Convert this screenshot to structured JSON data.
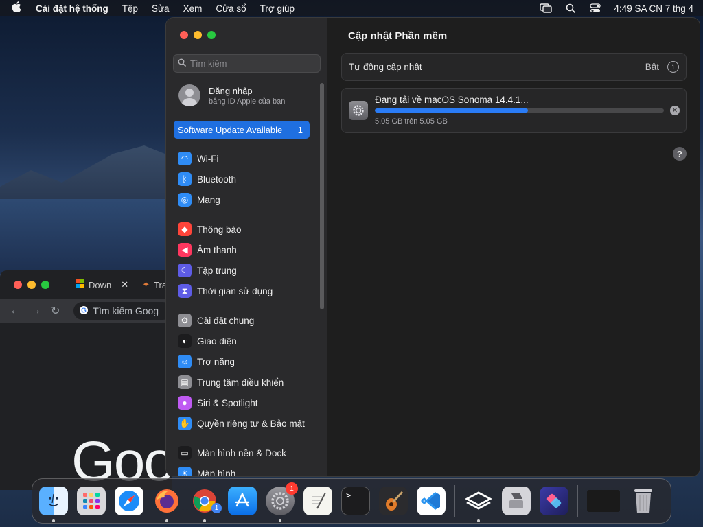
{
  "menubar": {
    "app_name": "Cài đặt hệ thống",
    "items": [
      "Tệp",
      "Sửa",
      "Xem",
      "Cửa sổ",
      "Trợ giúp"
    ],
    "clock": "4:49 SA CN 7 thg 4"
  },
  "chrome": {
    "tab1": "Down",
    "tab2": "Tra",
    "omnibox_placeholder": "Tìm kiếm Goog",
    "logo_text": "Goo"
  },
  "sidebar": {
    "search_placeholder": "Tìm kiếm",
    "account_name": "Đăng nhập",
    "account_sub": "bằng ID Apple của bạn",
    "update_label": "Software Update Available",
    "update_count": "1",
    "groups": [
      [
        {
          "label": "Wi-Fi",
          "icon": "wifi-icon",
          "color": "#2f8cf5"
        },
        {
          "label": "Bluetooth",
          "icon": "bluetooth-icon",
          "color": "#2f8cf5"
        },
        {
          "label": "Mạng",
          "icon": "globe-icon",
          "color": "#2f8cf5"
        }
      ],
      [
        {
          "label": "Thông báo",
          "icon": "bell-icon",
          "color": "#ff453a"
        },
        {
          "label": "Âm thanh",
          "icon": "speaker-icon",
          "color": "#ff375f"
        },
        {
          "label": "Tập trung",
          "icon": "moon-icon",
          "color": "#5e5ce6"
        },
        {
          "label": "Thời gian sử dụng",
          "icon": "hourglass-icon",
          "color": "#5e5ce6"
        }
      ],
      [
        {
          "label": "Cài đặt chung",
          "icon": "gear-icon",
          "color": "#8e8e93"
        },
        {
          "label": "Giao diện",
          "icon": "appearance-icon",
          "color": "#1c1c1e"
        },
        {
          "label": "Trợ năng",
          "icon": "accessibility-icon",
          "color": "#2f8cf5"
        },
        {
          "label": "Trung tâm điều khiển",
          "icon": "control-center-icon",
          "color": "#8e8e93"
        },
        {
          "label": "Siri & Spotlight",
          "icon": "siri-icon",
          "color": "#bf5af2"
        },
        {
          "label": "Quyền riêng tư & Bảo mật",
          "icon": "hand-icon",
          "color": "#2f8cf5"
        }
      ],
      [
        {
          "label": "Màn hình nền & Dock",
          "icon": "dock-icon",
          "color": "#1c1c1e"
        },
        {
          "label": "Màn hình",
          "icon": "sun-icon",
          "color": "#2f8cf5"
        }
      ]
    ]
  },
  "main": {
    "title": "Cập nhật Phần mềm",
    "auto_update_label": "Tự động cập nhật",
    "auto_update_value": "Bật",
    "download_label": "Đang tải về macOS Sonoma 14.4.1...",
    "download_progress": 0.53,
    "download_size": "5.05 GB trên 5.05 GB"
  },
  "dock": {
    "settings_badge": "1",
    "chrome_badge": "1"
  }
}
